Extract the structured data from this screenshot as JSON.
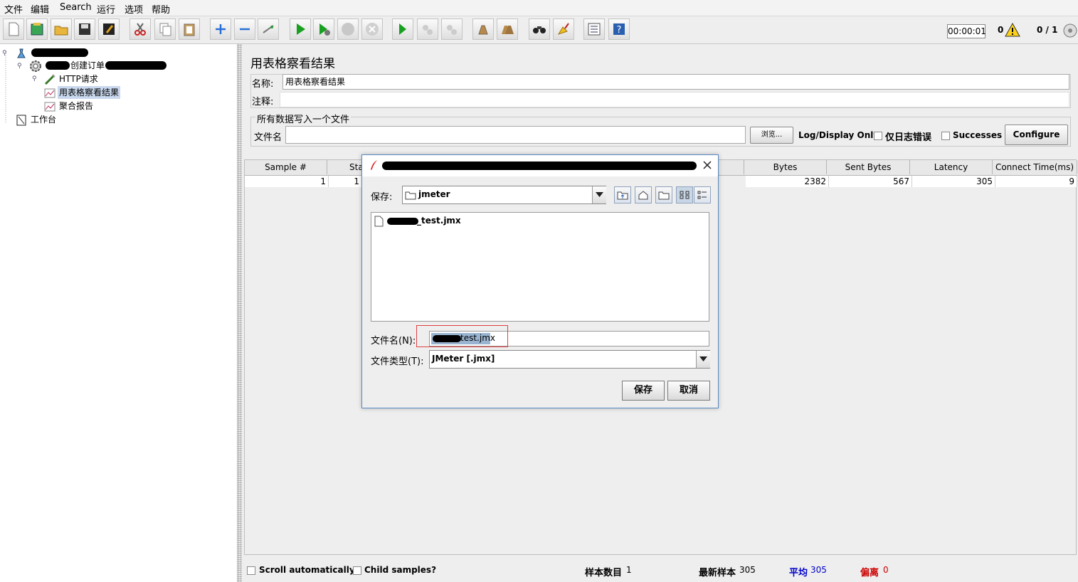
{
  "menu": [
    "文件",
    "编辑",
    "Search",
    "运行",
    "选项",
    "帮助"
  ],
  "toolbar": {
    "timer": "00:00:01",
    "warning_count": "0",
    "threads": "0 / 1"
  },
  "tree": {
    "items": [
      {
        "label": "创建订单",
        "icon": "thread-group-icon"
      },
      {
        "label": "HTTP请求",
        "icon": "http-sampler-icon"
      },
      {
        "label": "用表格察看结果",
        "icon": "listener-icon"
      },
      {
        "label": "聚合报告",
        "icon": "listener-icon"
      },
      {
        "label": "工作台",
        "icon": "workbench-icon"
      }
    ]
  },
  "panel": {
    "title": "用表格察看结果",
    "name_label": "名称:",
    "name_value": "用表格察看结果",
    "comment_label": "注释:",
    "comment_value": "",
    "group_title": "所有数据写入一个文件",
    "filename_label": "文件名",
    "filename_value": "",
    "browse_label": "浏览...",
    "log_display_label": "Log/Display Only:",
    "errors_label": "仅日志错误",
    "successes_label": "Successes",
    "configure_label": "Configure"
  },
  "table": {
    "headers": [
      "Sample #",
      "Sta",
      "Bytes",
      "Sent Bytes",
      "Latency",
      "Connect Time(ms)"
    ],
    "row": {
      "sample": "1",
      "status": "1",
      "bytes": "2382",
      "sent_bytes": "567",
      "latency": "305",
      "connect_time": "9"
    }
  },
  "footer": {
    "scroll_label": "Scroll automatically?",
    "child_label": "Child samples?",
    "sample_count_label": "样本数目",
    "sample_count_value": "1",
    "latest_label": "最新样本",
    "latest_value": "305",
    "avg_label": "平均",
    "avg_value": "305",
    "dev_label": "偏离",
    "dev_value": "0",
    "colors": {
      "avg": "#0000cc",
      "dev": "#cc0000"
    }
  },
  "dialog": {
    "save_in_label": "保存:",
    "folder": "jmeter",
    "files": [
      "_test.jmx"
    ],
    "filename_label": "文件名(N):",
    "filename_value": "test.jmx",
    "filetype_label": "文件类型(T):",
    "filetype_value": "JMeter [.jmx]",
    "save_button": "保存",
    "cancel_button": "取消"
  }
}
